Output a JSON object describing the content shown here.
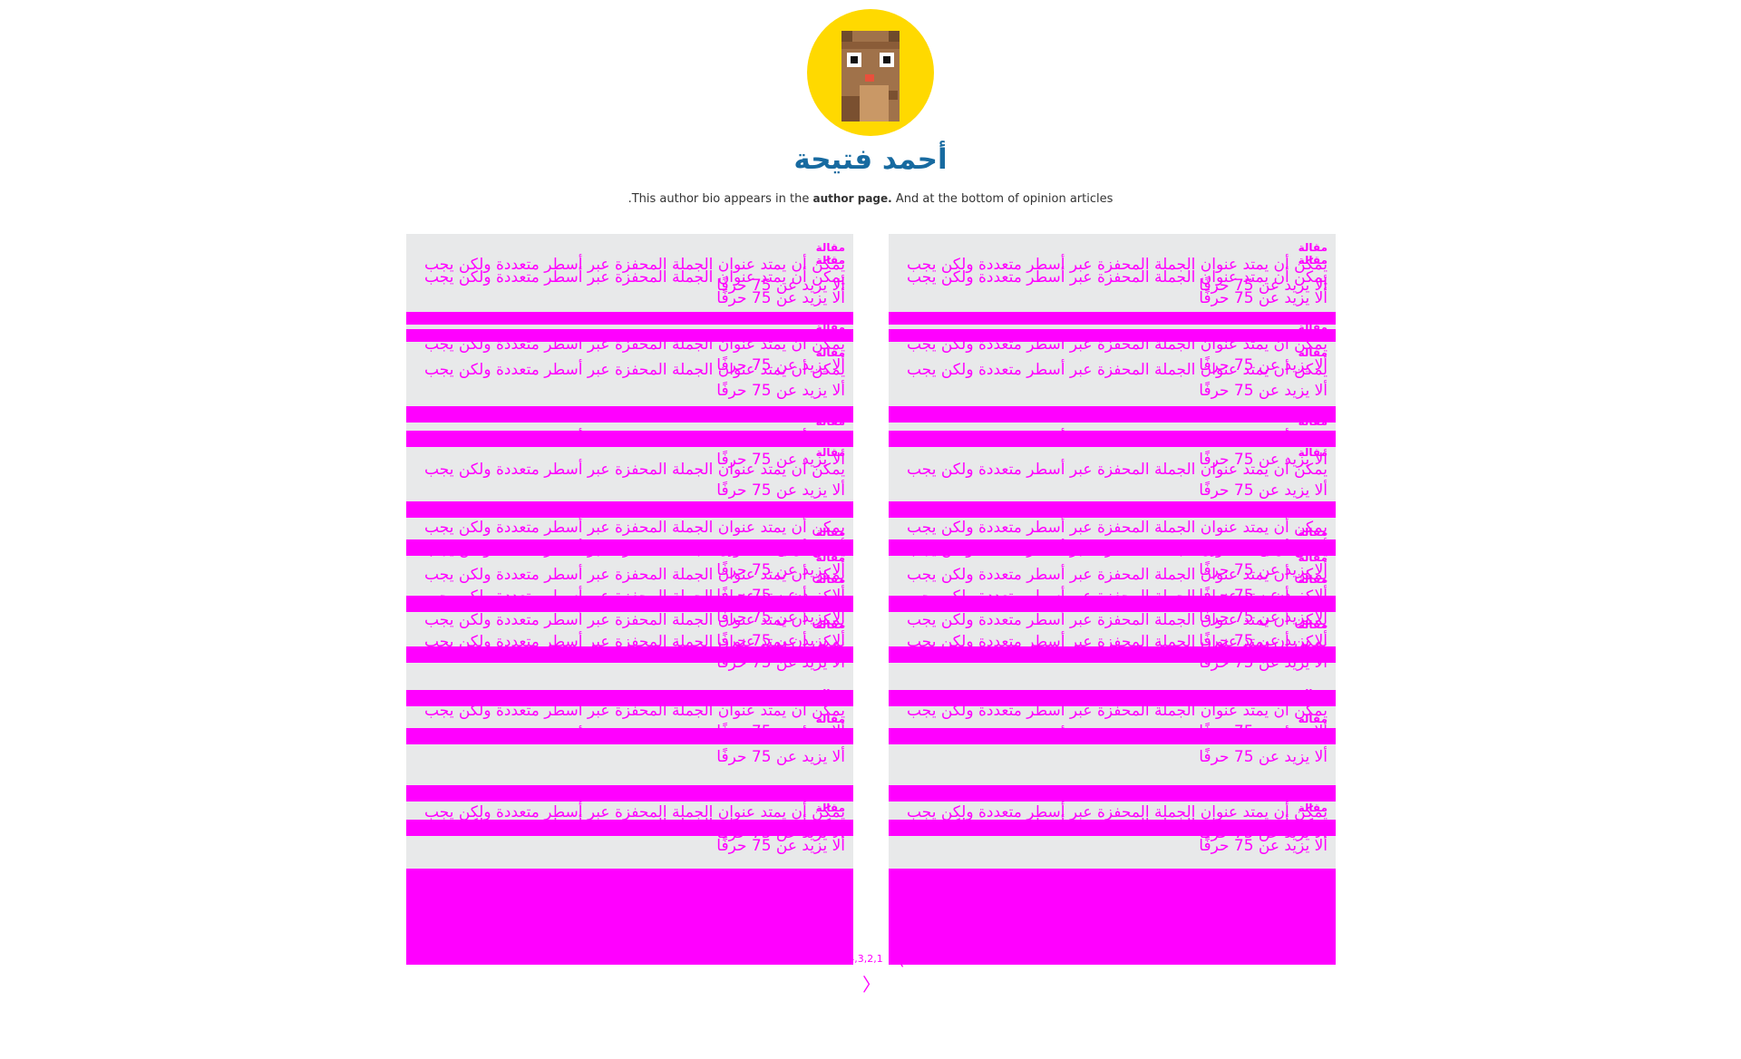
{
  "author": {
    "name": "أحمد فتيحة",
    "bio_start": ".This author bio appears in the",
    "bio_link": "author page.",
    "bio_end": "And at the bottom of opinion articles"
  },
  "card": {
    "label": "مقالة",
    "headline": "يمكن أن يمتد عنوان الجملة المحفزة عبر أسطر متعددة ولكن يجب ألا يزيد عن 75 حرفًا"
  },
  "pagination": {
    "text": "6,4,3,2,1",
    "prev": "〈",
    "next": "〉"
  },
  "colors": {
    "accent": "#ff00ff",
    "author_name": "#176aa0",
    "avatar_bg": "#ffd900",
    "card_bg": "#e8e9ea"
  },
  "icons": {
    "avatar": "pixel-bear-avatar"
  }
}
